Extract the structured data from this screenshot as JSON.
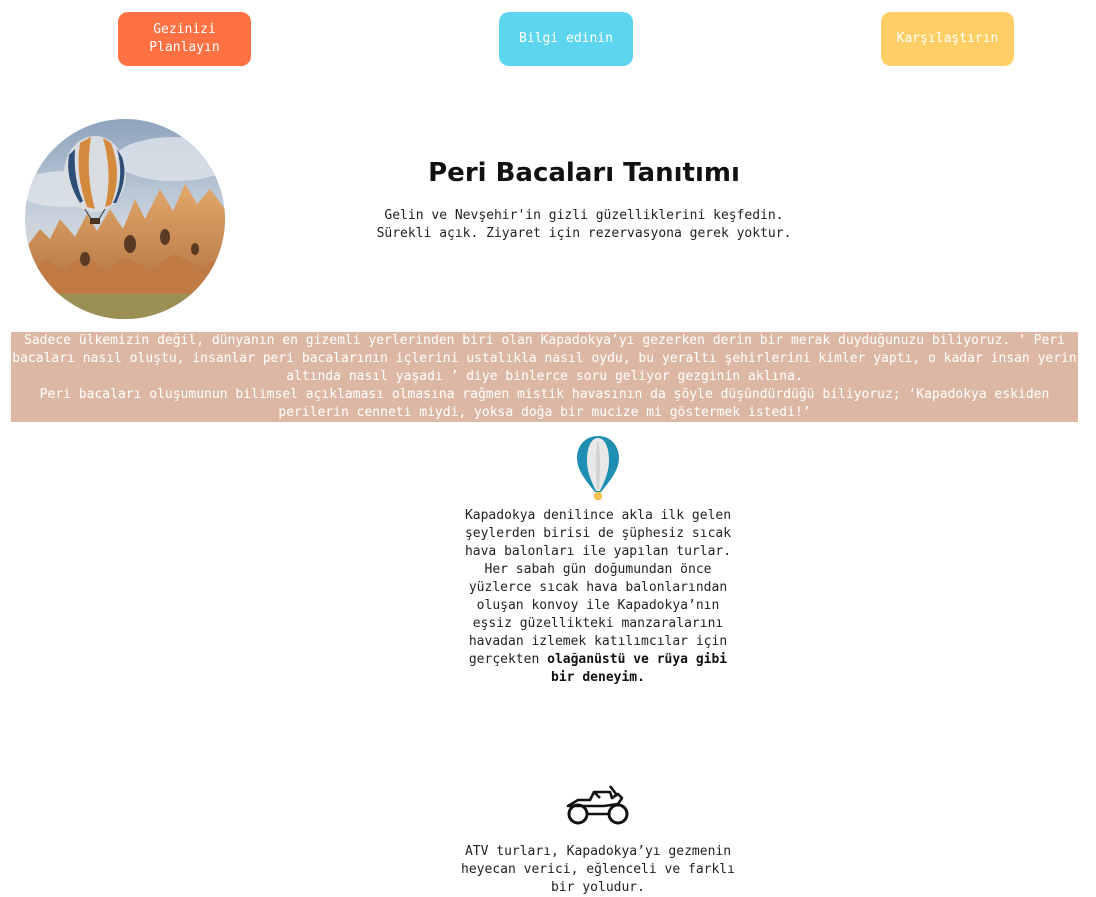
{
  "nav": {
    "plan_label": "Gezinizi Planlayın",
    "info_label": "Bilgi edinin",
    "compare_label": "Karşılaştırın",
    "colors": {
      "plan": "#ff7043",
      "info": "#5dd5ee",
      "compare": "#ffcf66"
    }
  },
  "hero": {
    "title": "Peri Bacaları Tanıtımı",
    "subtitle_line1": "Gelin ve Nevşehir'in gizli güzelliklerini keşfedin.",
    "subtitle_line2": "Sürekli açık. Ziyaret için rezervasyona gerek yoktur."
  },
  "banner": {
    "paragraph1": "Sadece ülkemizin değil, dünyanın en gizemli yerlerinden biri olan Kapadokya’yı gezerken derin bir merak duyduğunuzu biliyoruz. ‘ Peri bacaları nasıl oluştu, insanlar peri bacalarının içlerini ustalıkla nasıl oydu, bu yeraltı şehirlerini kimler yaptı, o kadar insan yerin altında nasıl yaşadı ’ diye binlerce soru geliyor gezginin aklına.",
    "paragraph2": "Peri bacaları oluşumunun bilimsel açıklaması olmasına rağmen mistik havasının da şöyle düşündürdüğü biliyoruz; ‘Kapadokya eskiden perilerin cenneti miydi, yoksa doğa bir mucize mi göstermek istedi!’",
    "background": "#dcb8a4"
  },
  "balloon_section": {
    "icon": "hot-air-balloon-icon",
    "text": "Kapadokya denilince akla ilk gelen şeylerden birisi de şüphesiz sıcak hava balonları ile yapılan turlar. Her sabah gün doğumundan önce yüzlerce sıcak hava balonlarından oluşan konvoy ile Kapadokya’nın eşsiz güzellikteki manzaralarını havadan izlemek katılımcılar için gerçekten",
    "emphasis": "olağanüstü ve rüya gibi bir deneyim."
  },
  "atv_section": {
    "icon": "motorcycle-icon",
    "text": "ATV turları, Kapadokya’yı gezmenin heyecan verici, eğlenceli ve farklı bir yoludur."
  }
}
